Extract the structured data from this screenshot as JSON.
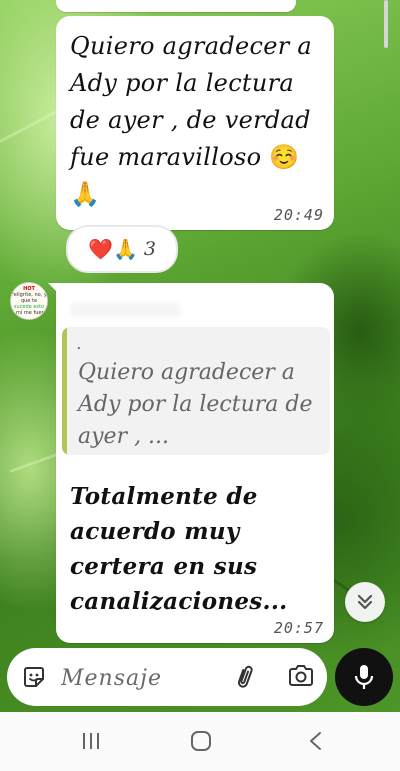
{
  "chat": {
    "messages": [
      {
        "text": "Quiero agradecer a Ady por la lectura de ayer , de verdad fue maravilloso",
        "emoji_inline": "☺️",
        "emoji_end": "🙏",
        "time": "20:49",
        "reactions": {
          "emoji": "❤️🙏",
          "count": "3"
        }
      },
      {
        "avatar_text": [
          "HOT",
          "Felígrite, no,",
          "y que te",
          "sucede esto",
          "a mí me fuera"
        ],
        "quoted": {
          "author": ".",
          "text": "Quiero agradecer a Ady por la lectura de ayer , ..."
        },
        "text": "Totalmente de acuerdo muy certera en sus canalizaciones...",
        "time": "20:57"
      }
    ]
  },
  "composer": {
    "placeholder": "Mensaje"
  },
  "icons": {
    "sticker": "sticker-icon",
    "attach": "paperclip-icon",
    "camera": "camera-icon",
    "mic": "microphone-icon",
    "scroll_down": "double-chevron-down-icon",
    "nav_recent": "recent-apps-icon",
    "nav_home": "home-icon",
    "nav_back": "back-icon"
  },
  "colors": {
    "bubble": "#ffffff",
    "quote_bar": "#b5c454",
    "mic_button": "#111111"
  }
}
